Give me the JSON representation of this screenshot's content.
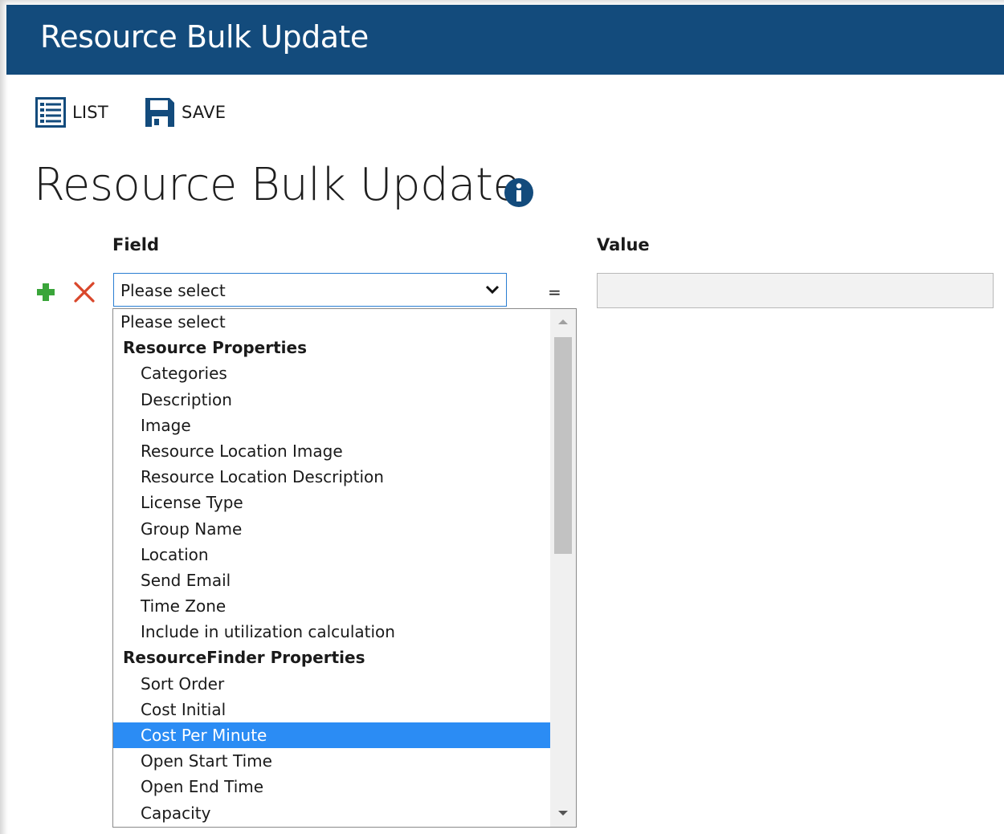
{
  "header": {
    "title": "Resource Bulk Update"
  },
  "toolbar": {
    "list_label": "LIST",
    "save_label": "SAVE"
  },
  "page": {
    "title": "Resource Bulk Update"
  },
  "columns": {
    "field": "Field",
    "value": "Value"
  },
  "row": {
    "field_select_value": "Please select",
    "operator": "=",
    "value": ""
  },
  "dropdown": {
    "items": [
      {
        "type": "top",
        "label": "Please select"
      },
      {
        "type": "group",
        "label": "Resource Properties"
      },
      {
        "type": "opt",
        "label": "Categories"
      },
      {
        "type": "opt",
        "label": "Description"
      },
      {
        "type": "opt",
        "label": "Image"
      },
      {
        "type": "opt",
        "label": "Resource Location Image"
      },
      {
        "type": "opt",
        "label": "Resource Location Description"
      },
      {
        "type": "opt",
        "label": "License Type"
      },
      {
        "type": "opt",
        "label": "Group Name"
      },
      {
        "type": "opt",
        "label": "Location"
      },
      {
        "type": "opt",
        "label": "Send Email"
      },
      {
        "type": "opt",
        "label": "Time Zone"
      },
      {
        "type": "opt",
        "label": "Include in utilization calculation"
      },
      {
        "type": "group",
        "label": "ResourceFinder Properties"
      },
      {
        "type": "opt",
        "label": "Sort Order"
      },
      {
        "type": "opt",
        "label": "Cost Initial"
      },
      {
        "type": "opt",
        "label": "Cost Per Minute",
        "selected": true
      },
      {
        "type": "opt",
        "label": "Open Start Time"
      },
      {
        "type": "opt",
        "label": "Open End Time"
      },
      {
        "type": "opt",
        "label": "Capacity"
      }
    ]
  },
  "colors": {
    "header_bg": "#134b7c",
    "selected_bg": "#2b8cf4",
    "add_green": "#3aa53a",
    "remove_red": "#d9472b",
    "info_navy": "#134b7c"
  },
  "icons": {
    "list": "list-icon",
    "save": "save-icon",
    "info": "info-icon",
    "add": "plus-icon",
    "remove": "close-icon",
    "dropdown": "chevron-down-icon"
  }
}
